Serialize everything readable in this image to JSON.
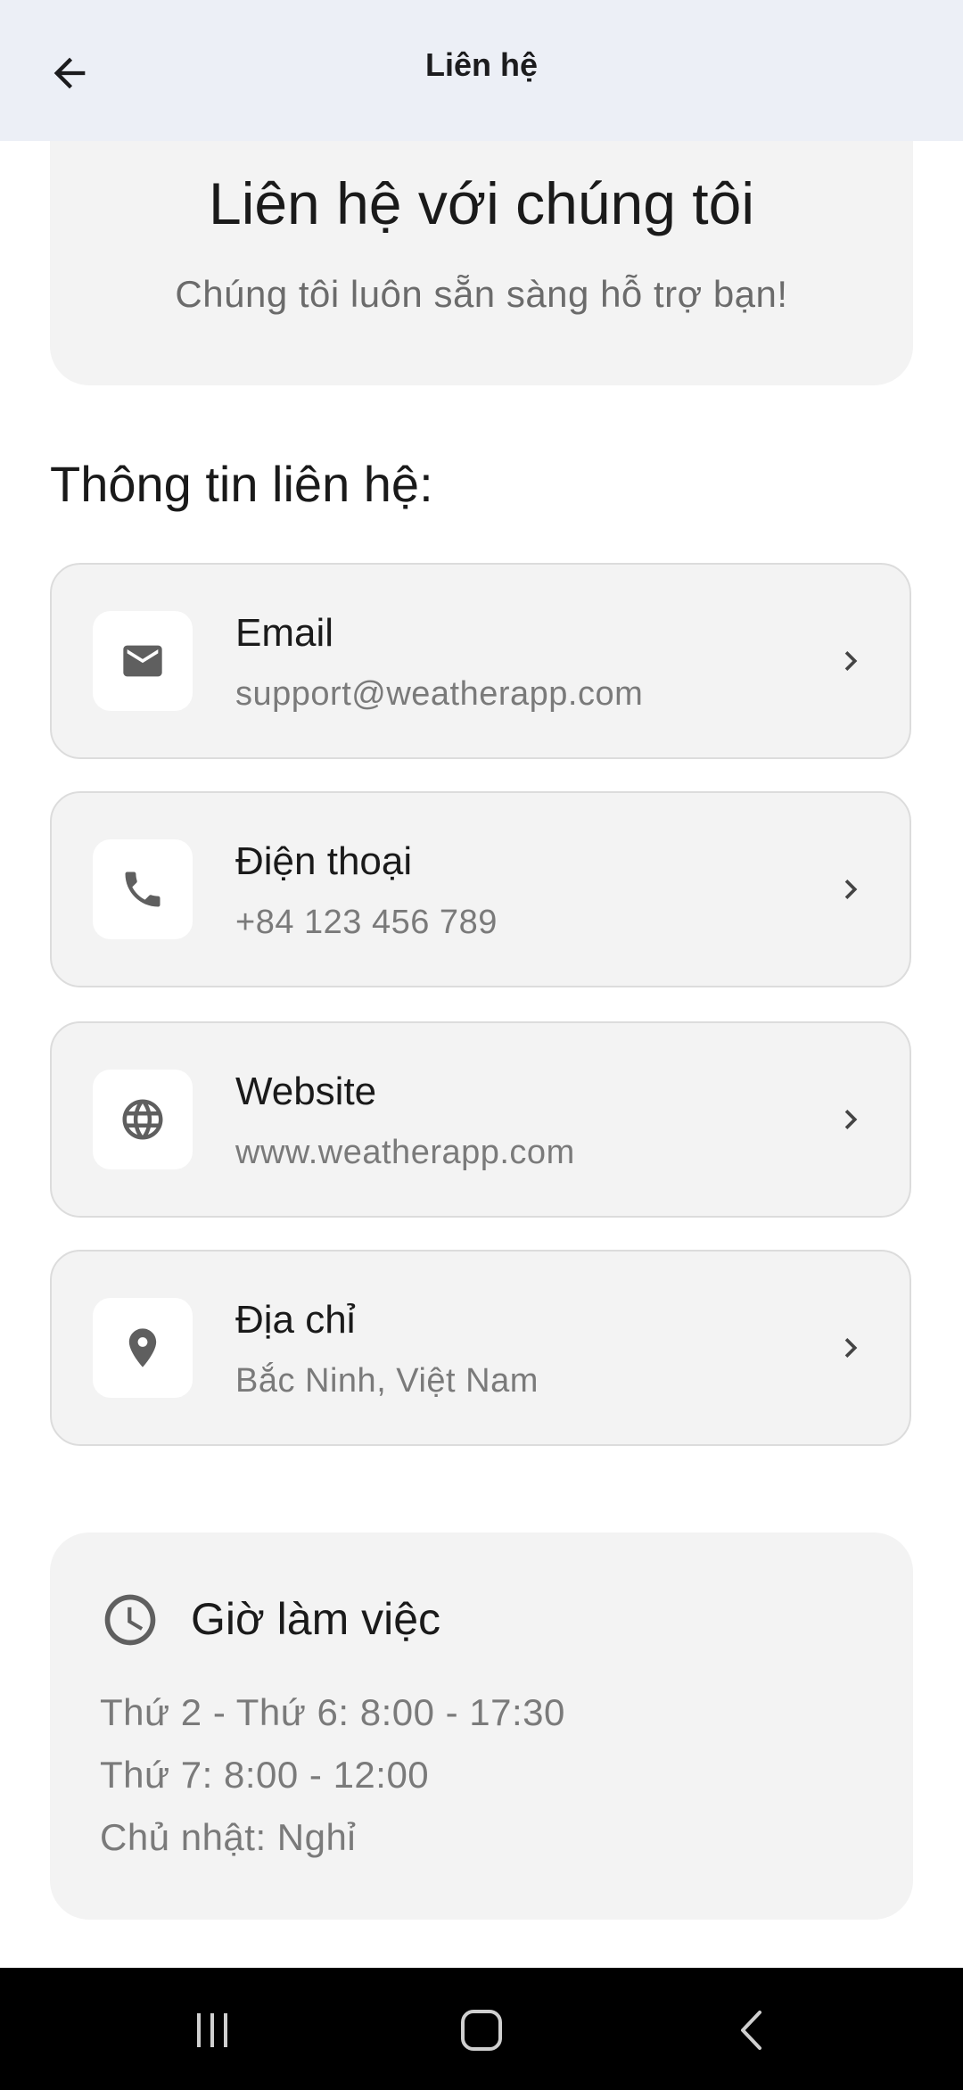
{
  "app_bar": {
    "title": "Liên hệ",
    "back_icon": "arrow-left-icon"
  },
  "hero": {
    "title": "Liên hệ với chúng tôi",
    "subtitle": "Chúng tôi luôn sẵn sàng hỗ trợ bạn!"
  },
  "section": {
    "title": "Thông tin liên hệ:"
  },
  "contacts": [
    {
      "label": "Email",
      "value": "support@weatherapp.com",
      "icon": "mail-icon"
    },
    {
      "label": "Điện thoại",
      "value": "+84 123 456 789",
      "icon": "phone-icon"
    },
    {
      "label": "Website",
      "value": "www.weatherapp.com",
      "icon": "globe-icon"
    },
    {
      "label": "Địa chỉ",
      "value": "Bắc Ninh, Việt Nam",
      "icon": "location-pin-icon"
    }
  ],
  "hours": {
    "title": "Giờ làm việc",
    "icon": "clock-icon",
    "lines": [
      "Thứ 2 - Thứ 6: 8:00 - 17:30",
      "Thứ 7: 8:00 - 12:00",
      "Chủ nhật: Nghỉ"
    ]
  },
  "system_nav": {
    "recents_icon": "recents-icon",
    "home_icon": "home-icon",
    "back_icon": "back-chevron-icon"
  },
  "colors": {
    "app_bar_bg": "#eceff6",
    "card_bg": "#f3f3f3",
    "icon_color": "#5f5f5f"
  }
}
